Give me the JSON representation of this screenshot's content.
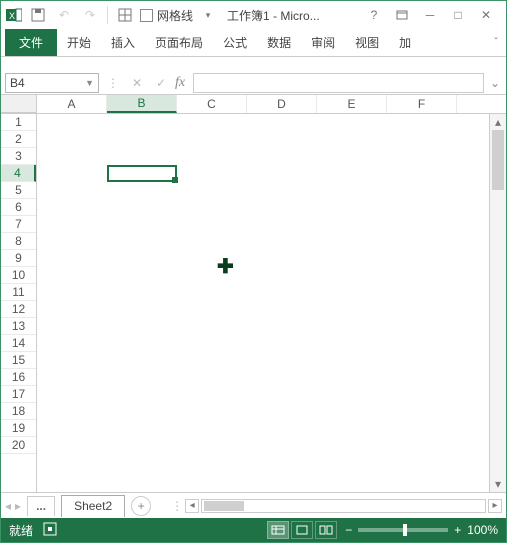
{
  "qat": {
    "gridlines_label": "网格线"
  },
  "title": "工作簿1 - Micro...",
  "ribbon": {
    "file": "文件",
    "tabs": [
      "开始",
      "插入",
      "页面布局",
      "公式",
      "数据",
      "审阅",
      "视图",
      "加"
    ]
  },
  "namebox": {
    "value": "B4"
  },
  "formula_bar": {
    "fx": "fx",
    "value": ""
  },
  "columns": [
    "A",
    "B",
    "C",
    "D",
    "E",
    "F"
  ],
  "rows": [
    "1",
    "2",
    "3",
    "4",
    "5",
    "6",
    "7",
    "8",
    "9",
    "10",
    "11",
    "12",
    "13",
    "14",
    "15",
    "16",
    "17",
    "18",
    "19",
    "20"
  ],
  "selection": {
    "col_index": 1,
    "row_index": 3
  },
  "sheetbar": {
    "ellipsis": "...",
    "active_sheet": "Sheet2"
  },
  "statusbar": {
    "ready": "就绪",
    "zoom_label": "100%"
  }
}
